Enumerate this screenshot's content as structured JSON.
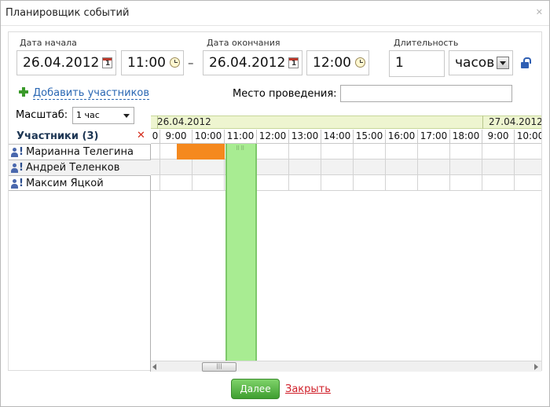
{
  "dialog": {
    "title": "Планировщик событий"
  },
  "start": {
    "label": "Дата начала",
    "date": "26.04.2012",
    "time": "11:00"
  },
  "separator": "–",
  "end": {
    "label": "Дата окончания",
    "date": "26.04.2012",
    "time": "12:00"
  },
  "calendar_icon_text": "1",
  "duration": {
    "label": "Длительность",
    "value": "1",
    "unit": "часов"
  },
  "add_participants": "Добавить участников",
  "place": {
    "label": "Место проведения:",
    "value": ""
  },
  "scale": {
    "label": "Масштаб:",
    "value": "1 час"
  },
  "participants": {
    "header": "Участники (3)",
    "list": [
      {
        "name": "Марианна Телегина",
        "marker": "!"
      },
      {
        "name": "Андрей Теленков",
        "marker": "!"
      },
      {
        "name": "Максим Яцкой",
        "marker": "!"
      }
    ]
  },
  "timeline": {
    "dates": [
      "26.04.2012",
      "27.04.2012"
    ],
    "hours": [
      "0",
      "9:00",
      "10:00",
      "11:00",
      "12:00",
      "13:00",
      "14:00",
      "15:00",
      "16:00",
      "17:00",
      "18:00",
      "9:00",
      "10:00"
    ],
    "busy": [
      {
        "participant": "Марианна Телегина",
        "from": "9:30",
        "to": "11:00"
      }
    ],
    "selected_event": {
      "from": "11:00",
      "to": "12:00"
    }
  },
  "scrollbar": {
    "thumb_grip": "|||"
  },
  "footer": {
    "next_label": "Далее",
    "close_label": "Закрыть"
  },
  "colors": {
    "busy": "#f5891e",
    "event": "#a8ec92",
    "next_button": "#3f9e30",
    "close_link": "#d0202a",
    "date_band": "#eef5d0"
  }
}
